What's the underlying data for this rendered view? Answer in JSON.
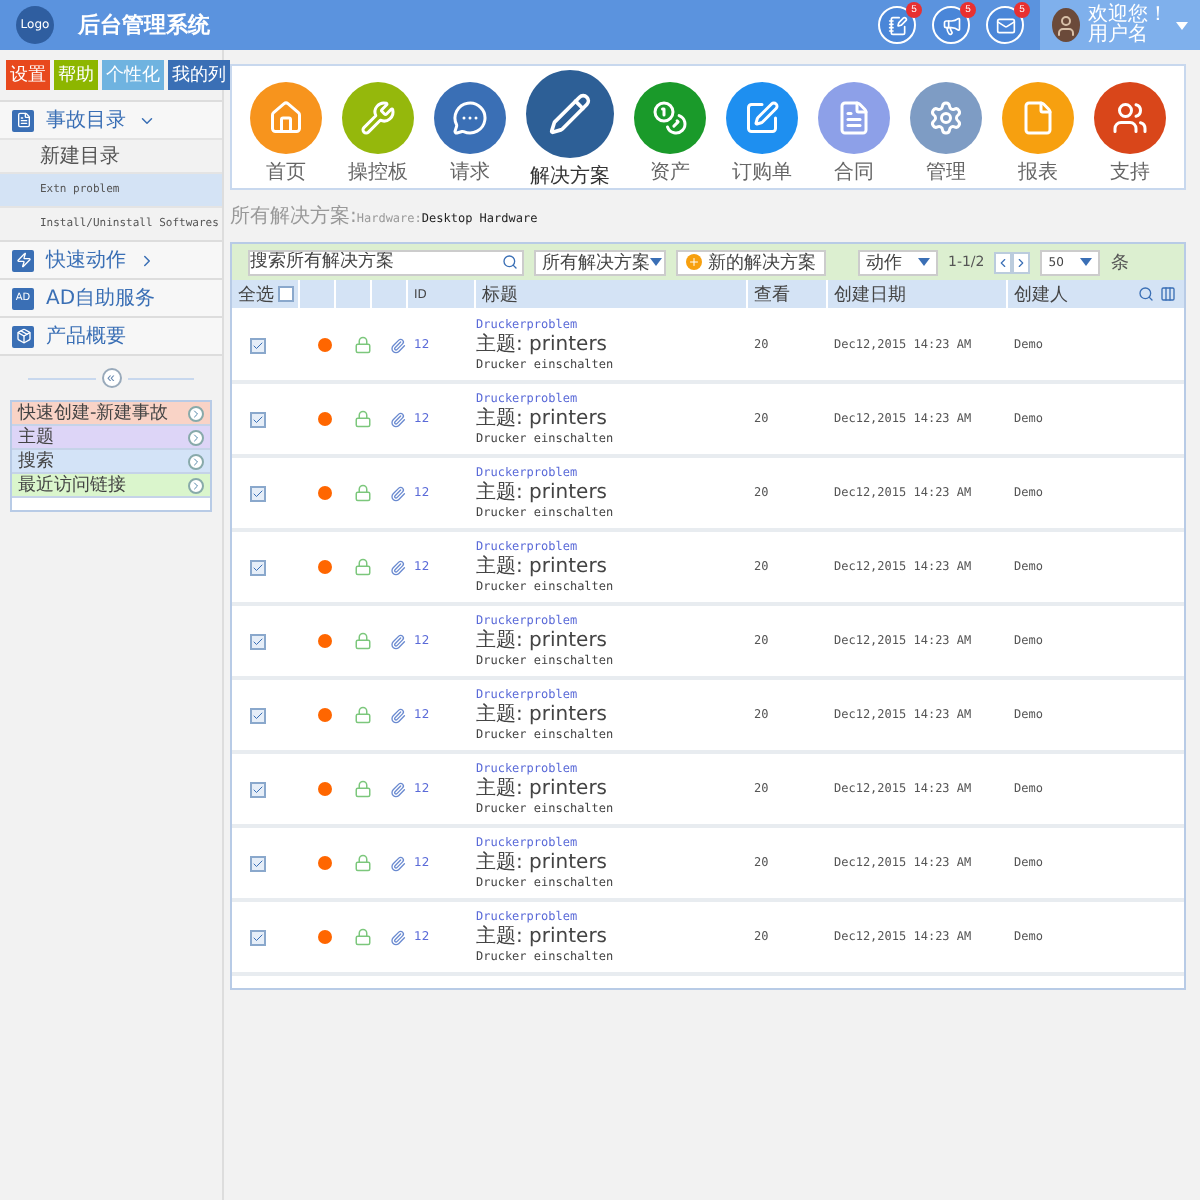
{
  "header": {
    "logo": "Logo",
    "title": "后台管理系统",
    "notifications": [
      {
        "badge": "5"
      },
      {
        "badge": "5"
      },
      {
        "badge": "5"
      }
    ],
    "user": {
      "greeting": "欢迎您！",
      "name": "用户名"
    }
  },
  "sidebar": {
    "buttons": [
      {
        "label": "设置",
        "color": "#e8491d"
      },
      {
        "label": "帮助",
        "color": "#8db600"
      },
      {
        "label": "个性化",
        "color": "#6fb3e0"
      },
      {
        "label": "我的列",
        "color": "#3a6fb5"
      }
    ],
    "nav": [
      {
        "kind": "group",
        "label": "事故目录",
        "expanded": true,
        "children": [
          {
            "label": "新建目录",
            "selected": false
          },
          {
            "label": "Extn problem",
            "selected": true
          },
          {
            "label": "Install/Uninstall Softwares",
            "selected": false
          }
        ]
      },
      {
        "kind": "group",
        "label": "快速动作",
        "expanded": false
      },
      {
        "kind": "link",
        "label": "AD自助服务",
        "icon_text": "AD"
      },
      {
        "kind": "link",
        "label": "产品概要"
      }
    ],
    "collapse": "«",
    "quick_links": [
      {
        "label": "快速创建-新建事故",
        "color": "#f9d3c6"
      },
      {
        "label": "主题",
        "color": "#ddd5f7"
      },
      {
        "label": "搜索",
        "color": "#d3e3f7"
      },
      {
        "label": "最近访问链接",
        "color": "#daf5cc"
      }
    ]
  },
  "modules": [
    {
      "label": "首页",
      "color": "#f7941d",
      "selected": false
    },
    {
      "label": "操控板",
      "color": "#95b80c",
      "selected": false
    },
    {
      "label": "请求",
      "color": "#3a6fb5",
      "selected": false
    },
    {
      "label": "解决方案",
      "color": "#2d5f96",
      "selected": true
    },
    {
      "label": "资产",
      "color": "#1a9a2a",
      "selected": false
    },
    {
      "label": "订购单",
      "color": "#1e8ff0",
      "selected": false
    },
    {
      "label": "合同",
      "color": "#8da0e8",
      "selected": false
    },
    {
      "label": "管理",
      "color": "#7e9cc4",
      "selected": false
    },
    {
      "label": "报表",
      "color": "#f7a00f",
      "selected": false
    },
    {
      "label": "支持",
      "color": "#d9461a",
      "selected": false
    }
  ],
  "breadcrumb": [
    {
      "label": "所有解决方案:",
      "current": false
    },
    {
      "label": "Hardware:",
      "current": false
    },
    {
      "label": "Desktop Hardware",
      "current": true
    }
  ],
  "toolbar": {
    "search": {
      "placeholder": "搜索所有解决方案"
    },
    "filter": "所有解决方案",
    "new_button": "新的解决方案",
    "action": "动作",
    "pager": "1-1/2",
    "page_size": "50",
    "unit": "条"
  },
  "table": {
    "select_all": {
      "label": "全选",
      "checked": false
    },
    "columns": [
      "ID",
      "标题",
      "查看",
      "创建日期",
      "创建人"
    ],
    "rows": [
      {
        "checked": true,
        "color": "#ff6600",
        "id": "12",
        "title": "Druckerproblem",
        "subject": "主题: printers",
        "description": "Drucker einschalten",
        "views": "20",
        "date": "Dec12,2015 14:23 AM",
        "creator": "Demo"
      },
      {
        "checked": true,
        "color": "#ff6600",
        "id": "12",
        "title": "Druckerproblem",
        "subject": "主题: printers",
        "description": "Drucker einschalten",
        "views": "20",
        "date": "Dec12,2015 14:23 AM",
        "creator": "Demo"
      },
      {
        "checked": true,
        "color": "#ff6600",
        "id": "12",
        "title": "Druckerproblem",
        "subject": "主题: printers",
        "description": "Drucker einschalten",
        "views": "20",
        "date": "Dec12,2015 14:23 AM",
        "creator": "Demo"
      },
      {
        "checked": true,
        "color": "#ff6600",
        "id": "12",
        "title": "Druckerproblem",
        "subject": "主题: printers",
        "description": "Drucker einschalten",
        "views": "20",
        "date": "Dec12,2015 14:23 AM",
        "creator": "Demo"
      },
      {
        "checked": true,
        "color": "#ff6600",
        "id": "12",
        "title": "Druckerproblem",
        "subject": "主题: printers",
        "description": "Drucker einschalten",
        "views": "20",
        "date": "Dec12,2015 14:23 AM",
        "creator": "Demo"
      },
      {
        "checked": true,
        "color": "#ff6600",
        "id": "12",
        "title": "Druckerproblem",
        "subject": "主题: printers",
        "description": "Drucker einschalten",
        "views": "20",
        "date": "Dec12,2015 14:23 AM",
        "creator": "Demo"
      },
      {
        "checked": true,
        "color": "#ff6600",
        "id": "12",
        "title": "Druckerproblem",
        "subject": "主题: printers",
        "description": "Drucker einschalten",
        "views": "20",
        "date": "Dec12,2015 14:23 AM",
        "creator": "Demo"
      },
      {
        "checked": true,
        "color": "#ff6600",
        "id": "12",
        "title": "Druckerproblem",
        "subject": "主题: printers",
        "description": "Drucker einschalten",
        "views": "20",
        "date": "Dec12,2015 14:23 AM",
        "creator": "Demo"
      },
      {
        "checked": true,
        "color": "#ff6600",
        "id": "12",
        "title": "Druckerproblem",
        "subject": "主题: printers",
        "description": "Drucker einschalten",
        "views": "20",
        "date": "Dec12,2015 14:23 AM",
        "creator": "Demo"
      }
    ]
  }
}
